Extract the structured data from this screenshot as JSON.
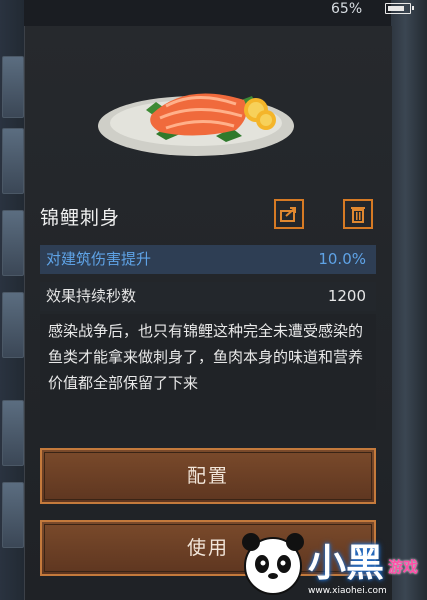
{
  "status": {
    "battery_percent": "65%"
  },
  "item": {
    "name": "锦鲤刺身",
    "stats": [
      {
        "label": "对建筑伤害提升",
        "value": "10.0%"
      },
      {
        "label": "效果持续秒数",
        "value": "1200"
      }
    ],
    "description": "感染战争后，也只有锦鲤这种完全未遭受感染的鱼类才能拿来做刺身了，鱼肉本身的味道和营养价值都全部保留了下来"
  },
  "actions": {
    "configure_label": "配置",
    "use_label": "使用"
  },
  "watermark": {
    "text": "小黑",
    "subtext": "游戏",
    "url": "www.xiaohei.com"
  },
  "colors": {
    "accent": "#d67a24",
    "stat_highlight": "#5fa3e6",
    "button_bg": "#6b3f24"
  }
}
